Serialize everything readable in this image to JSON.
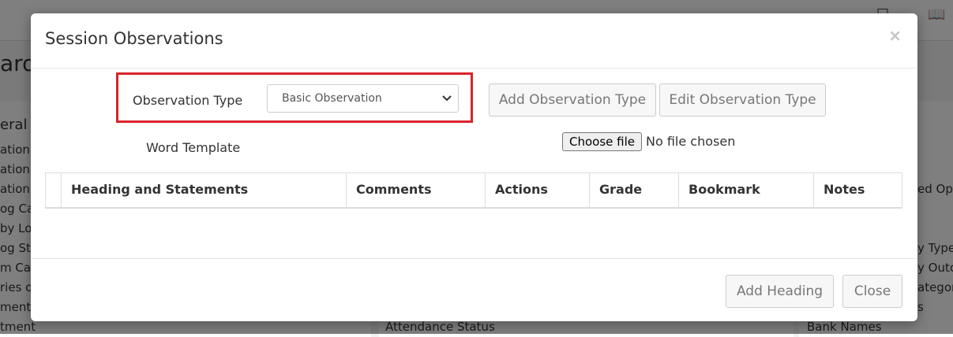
{
  "modal": {
    "title": "Session Observations",
    "close_glyph": "×",
    "observation_type_label": "Observation Type",
    "observation_type_selected": "Basic Observation",
    "add_observation_type": "Add Observation Type",
    "edit_observation_type": "Edit Observation Type",
    "word_template_label": "Word Template",
    "choose_file": "Choose file",
    "file_status": "No file chosen",
    "table_headers": [
      "Heading and Statements",
      "Comments",
      "Actions",
      "Grade",
      "Bookmark",
      "Notes"
    ],
    "add_heading": "Add Heading",
    "close": "Close"
  },
  "background": {
    "title_fragment": "ard",
    "section_fragment": "eral V",
    "left_lines": [
      "ation",
      "ation",
      "ation",
      "og Ca",
      "by Lo",
      "og St",
      "m Ca",
      "ries o",
      "ment",
      "tment"
    ],
    "mid_line": "Attendance Status",
    "right_lines": [
      "ed Opt",
      "y Types",
      "y Outc",
      "ategori",
      "s",
      "Bank Names"
    ]
  },
  "colors": {
    "highlight": "#d9232a",
    "overlay": "rgba(0,0,0,0.5)"
  },
  "icons": {
    "select_chevron": "chevron-down-icon",
    "close": "close-icon"
  }
}
